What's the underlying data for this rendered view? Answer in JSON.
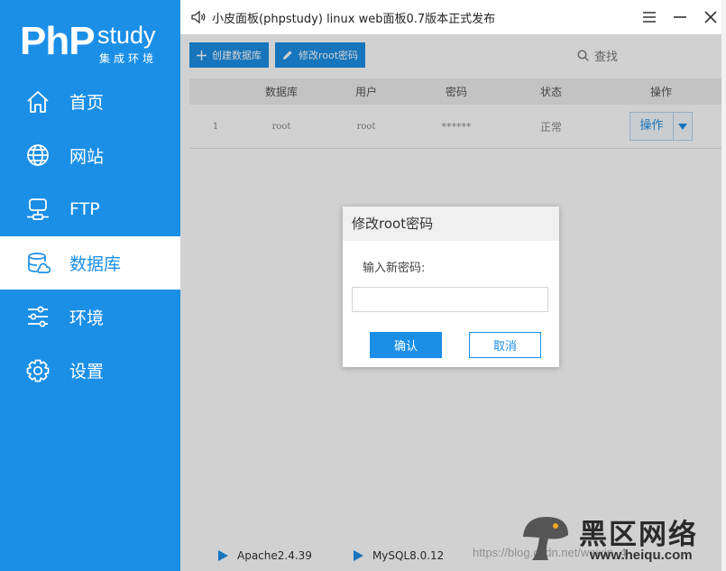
{
  "window": {
    "title": "小皮面板(phpstudy) linux web面板0.7版本正式发布",
    "colors": {
      "brand": "#1b8fe6",
      "overlay": "rgba(0,0,0,0.18)"
    }
  },
  "logo": {
    "php": "PhP",
    "study": "study",
    "subtitle": "集成环境"
  },
  "sidebar": {
    "items": [
      {
        "label": "首页",
        "icon": "home-icon",
        "active": false
      },
      {
        "label": "网站",
        "icon": "globe-icon",
        "active": false
      },
      {
        "label": "FTP",
        "icon": "ftp-server-icon",
        "active": false
      },
      {
        "label": "数据库",
        "icon": "database-icon",
        "active": true
      },
      {
        "label": "环境",
        "icon": "sliders-icon",
        "active": false
      },
      {
        "label": "设置",
        "icon": "gear-icon",
        "active": false
      }
    ]
  },
  "toolbar": {
    "create_db": "创建数据库",
    "change_root_pwd": "修改root密码",
    "search_label": "查找"
  },
  "table": {
    "headers": [
      "",
      "数据库",
      "用户",
      "密码",
      "状态",
      "操作"
    ],
    "rows": [
      {
        "index": "1",
        "database": "root",
        "user": "root",
        "password": "******",
        "status": "正常",
        "action": "操作"
      }
    ]
  },
  "statusbar": {
    "services": [
      "Apache2.4.39",
      "MySQL8.0.12"
    ]
  },
  "dialog": {
    "title": "修改root密码",
    "label": "输入新密码:",
    "input_value": "",
    "ok": "确认",
    "cancel": "取消"
  },
  "watermark": {
    "url": "https://blog.csdn.net/weixin_4",
    "brand": "黑区网络",
    "brand_url": "www.heiqu.com"
  }
}
